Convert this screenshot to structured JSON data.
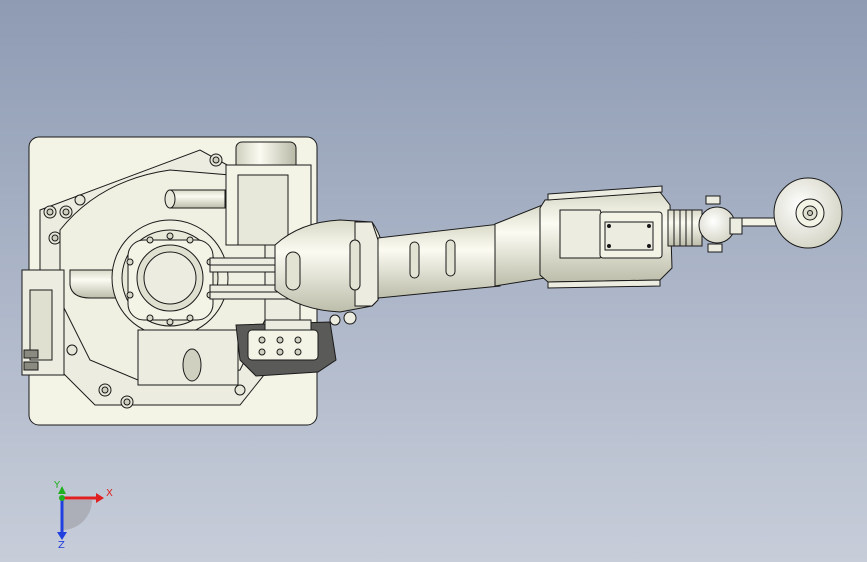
{
  "view": {
    "background_top": "#8e9bb3",
    "background_bottom": "#c7cdd9",
    "part_fill": "#f3f3e6",
    "edge_color": "#1a1a1a"
  },
  "triad": {
    "x_label": "X",
    "y_label": "Y",
    "z_label": "Z",
    "x_color": "#e02020",
    "y_color": "#20b020",
    "z_color": "#2040e0"
  }
}
